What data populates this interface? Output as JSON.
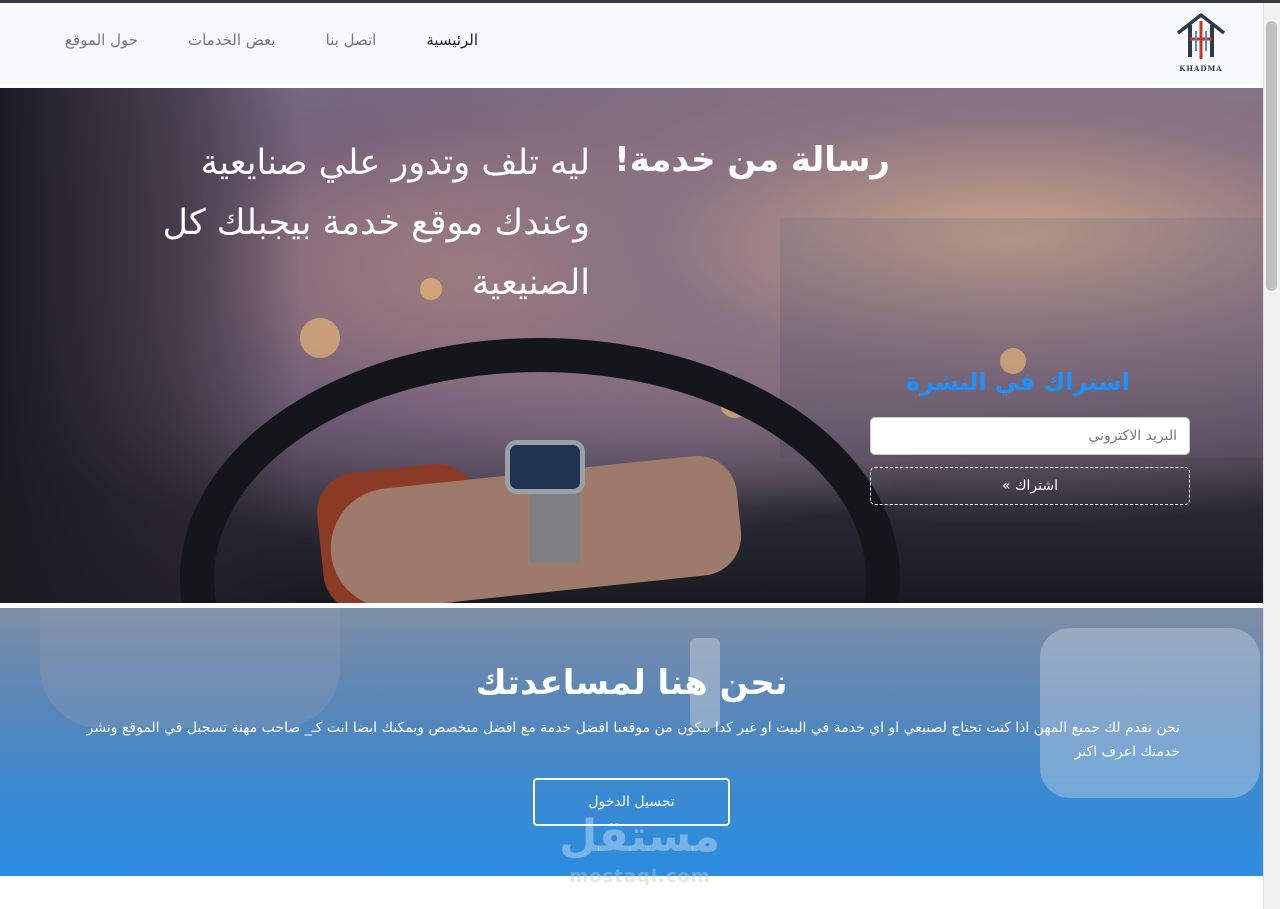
{
  "nav": {
    "items": [
      {
        "label": "الرئيسية",
        "active": true
      },
      {
        "label": "اتصل بنا",
        "active": false
      },
      {
        "label": "بعض الخدمات",
        "active": false
      },
      {
        "label": "حول الموقع",
        "active": false
      }
    ],
    "logo_text": "KHADMA"
  },
  "hero": {
    "tagline": "ليه تلف وتدور علي صنايعية وعندك موقع خدمة بيجبلك كل الصنيعية",
    "title": "رسالة من خدمة!",
    "newsletter": {
      "title": "اشتراك في النشرة",
      "email_placeholder": "البريد الاكتروني",
      "button_label": "اشتراك »"
    }
  },
  "help": {
    "title": "نحن هنا لمساعدتك",
    "description": "نحن نقدم لك جميع المهن اذا كنت تحتاج لصنيعي او اي خدمة في البيت او غير كدا بيكون من موقعنا افضل خدمة مع افضل متخصص ويمكنك ايضا انت كـ_ صاحب مهنة تسجيل في الموقع ونشر خدمتك اعرف اكتر",
    "button_label": "تجسيل الدخول"
  },
  "watermark": {
    "arabic": "مستقل",
    "latin": "mostaql.com"
  },
  "colors": {
    "accent": "#1e90ff",
    "navbar_bg": "#f8f9fa",
    "help_bg": "#2b8ce0"
  }
}
